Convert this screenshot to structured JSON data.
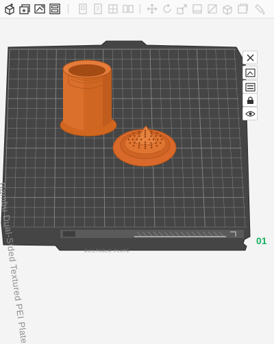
{
  "toolbar": {
    "groups": [
      [
        "add-icon",
        "add-plate-icon",
        "auto-orient-icon",
        "arrange-icon"
      ],
      [
        "copy-icon",
        "paste-icon",
        "split-to-objects-icon",
        "split-to-parts-icon"
      ],
      [
        "move-icon",
        "rotate-icon",
        "scale-icon",
        "lay-on-face-icon",
        "cut-icon",
        "support-paint-icon",
        "seam-paint-icon"
      ]
    ]
  },
  "plate": {
    "name_label": "Bambu Dual-Sided Textured PEI Plate",
    "strip_text": "BUILTABLE PLATE",
    "number": "01"
  },
  "plate_buttons": [
    "close-plate-icon",
    "auto-orient-plate-icon",
    "arrange-plate-icon",
    "lock-plate-icon",
    "plate-settings-icon"
  ],
  "colors": {
    "plate": "#454545",
    "grid": "#8a8a8a",
    "filament": "#e07230",
    "plate_number": "#17b15d",
    "background": "#f4f4f4"
  }
}
